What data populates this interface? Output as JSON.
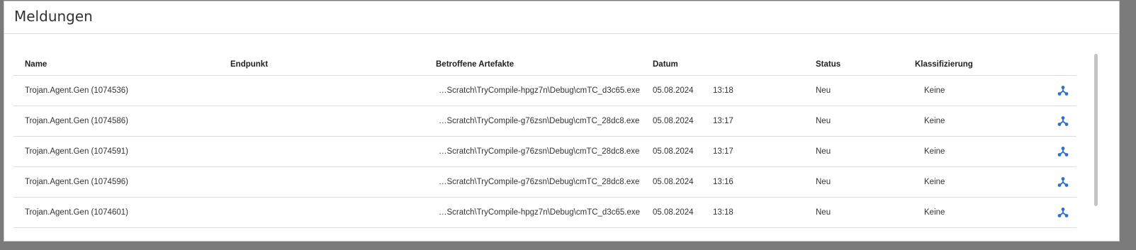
{
  "header": {
    "title": "Meldungen"
  },
  "table": {
    "columns": {
      "name": "Name",
      "endpoint": "Endpunkt",
      "artifact": "Betroffene Artefakte",
      "date": "Datum",
      "status": "Status",
      "classification": "Klassifizierung"
    },
    "rows": [
      {
        "name": "Trojan.Agent.Gen (1074536)",
        "endpoint": "",
        "artifact": "…Scratch\\TryCompile-hpgz7n\\Debug\\cmTC_d3c65.exe",
        "date": "05.08.2024",
        "time": "13:18",
        "status": "Neu",
        "classification": "Keine"
      },
      {
        "name": "Trojan.Agent.Gen (1074586)",
        "endpoint": "",
        "artifact": "…Scratch\\TryCompile-g76zsn\\Debug\\cmTC_28dc8.exe",
        "date": "05.08.2024",
        "time": "13:17",
        "status": "Neu",
        "classification": "Keine"
      },
      {
        "name": "Trojan.Agent.Gen (1074591)",
        "endpoint": "",
        "artifact": "…Scratch\\TryCompile-g76zsn\\Debug\\cmTC_28dc8.exe",
        "date": "05.08.2024",
        "time": "13:17",
        "status": "Neu",
        "classification": "Keine"
      },
      {
        "name": "Trojan.Agent.Gen (1074596)",
        "endpoint": "",
        "artifact": "…Scratch\\TryCompile-g76zsn\\Debug\\cmTC_28dc8.exe",
        "date": "05.08.2024",
        "time": "13:16",
        "status": "Neu",
        "classification": "Keine"
      },
      {
        "name": "Trojan.Agent.Gen (1074601)",
        "endpoint": "",
        "artifact": "…Scratch\\TryCompile-hpgz7n\\Debug\\cmTC_d3c65.exe",
        "date": "05.08.2024",
        "time": "13:18",
        "status": "Neu",
        "classification": "Keine"
      }
    ],
    "action_icon": "network-graph-icon"
  },
  "colors": {
    "accent": "#2f6fcf",
    "background": "#ffffff",
    "frame": "#7a7a7a"
  }
}
